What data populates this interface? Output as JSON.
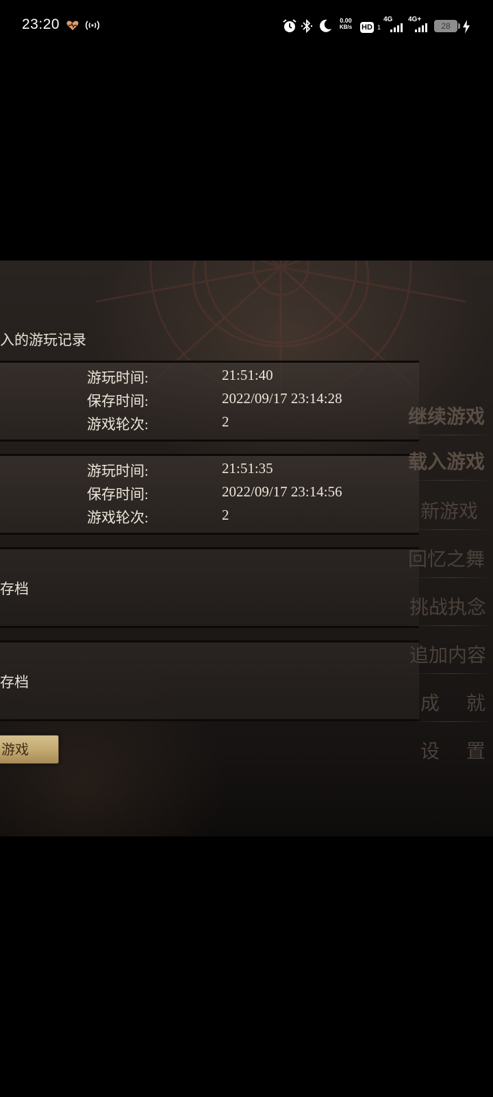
{
  "status_bar": {
    "time": "23:20",
    "network_speed_value": "0.00",
    "network_speed_unit": "KB/s",
    "hd_label": "HD",
    "hd_sub": "1",
    "sim1_label": "4G",
    "sim2_label": "4G+",
    "battery": "28"
  },
  "load_panel": {
    "title": "入的游玩记录",
    "slots": [
      {
        "play_time_label": "游玩时间:",
        "play_time_value": "21:51:40",
        "save_time_label": "保存时间:",
        "save_time_value": "2022/09/17 23:14:28",
        "round_label": "游戏轮次:",
        "round_value": "2"
      },
      {
        "play_time_label": "游玩时间:",
        "play_time_value": "21:51:35",
        "save_time_label": "保存时间:",
        "save_time_value": "2022/09/17 23:14:56",
        "round_label": "游戏轮次:",
        "round_value": "2"
      }
    ],
    "empty_slots": [
      "存档",
      "存档"
    ],
    "back_button": "游戏"
  },
  "main_menu": {
    "items": [
      "继续游戏",
      "载入游戏",
      "新游戏",
      "回忆之舞",
      "挑战执念",
      "追加内容",
      "成 就",
      "设 置"
    ]
  },
  "colors": {
    "button_bg": "#c9b07a",
    "panel_text": "#ece6da",
    "menu_text": "#4a413a"
  }
}
